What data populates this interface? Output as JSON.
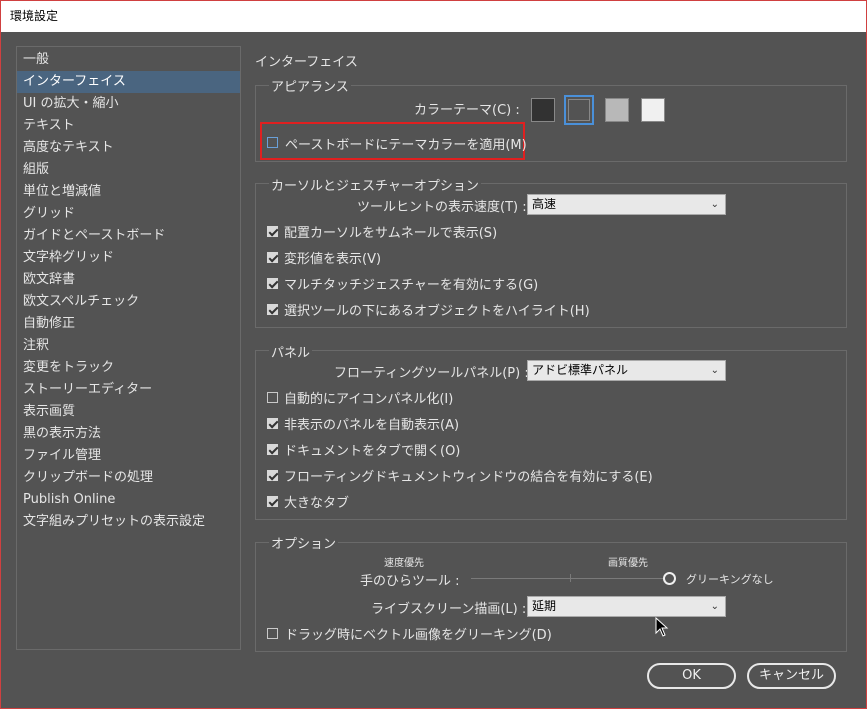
{
  "window": {
    "title": "環境設定"
  },
  "sidebar": {
    "items": [
      {
        "label": "一般"
      },
      {
        "label": "インターフェイス",
        "selected": true
      },
      {
        "label": "UI の拡大・縮小"
      },
      {
        "label": "テキスト"
      },
      {
        "label": "高度なテキスト"
      },
      {
        "label": "組版"
      },
      {
        "label": "単位と増減値"
      },
      {
        "label": "グリッド"
      },
      {
        "label": "ガイドとペーストボード"
      },
      {
        "label": "文字枠グリッド"
      },
      {
        "label": "欧文辞書"
      },
      {
        "label": "欧文スペルチェック"
      },
      {
        "label": "自動修正"
      },
      {
        "label": "注釈"
      },
      {
        "label": "変更をトラック"
      },
      {
        "label": "ストーリーエディター"
      },
      {
        "label": "表示画質"
      },
      {
        "label": "黒の表示方法"
      },
      {
        "label": "ファイル管理"
      },
      {
        "label": "クリップボードの処理"
      },
      {
        "label": "Publish Online"
      },
      {
        "label": "文字組みプリセットの表示設定"
      }
    ]
  },
  "main": {
    "title": "インターフェイス",
    "appearance": {
      "legend": "アピアランス",
      "color_theme_label": "カラーテーマ(C) :",
      "swatch_colors": [
        "#323232",
        "#535353",
        "#b8b8b8",
        "#f0f0f0"
      ],
      "selected_swatch": 1,
      "pasteboard_label": "ペーストボードにテーマカラーを適用(M)",
      "pasteboard_checked": false
    },
    "cursor_gesture": {
      "legend": "カーソルとジェスチャーオプション",
      "tooltip_label": "ツールヒントの表示速度(T) :",
      "tooltip_value": "高速",
      "checkboxes": [
        {
          "label": "配置カーソルをサムネールで表示(S)",
          "checked": true
        },
        {
          "label": "変形値を表示(V)",
          "checked": true
        },
        {
          "label": "マルチタッチジェスチャーを有効にする(G)",
          "checked": true
        },
        {
          "label": "選択ツールの下にあるオブジェクトをハイライト(H)",
          "checked": true
        }
      ]
    },
    "panels": {
      "legend": "パネル",
      "floating_label": "フローティングツールパネル(P) :",
      "floating_value": "アドビ標準パネル",
      "checkboxes": [
        {
          "label": "自動的にアイコンパネル化(I)",
          "checked": false
        },
        {
          "label": "非表示のパネルを自動表示(A)",
          "checked": true
        },
        {
          "label": "ドキュメントをタブで開く(O)",
          "checked": true
        },
        {
          "label": "フローティングドキュメントウィンドウの結合を有効にする(E)",
          "checked": true
        },
        {
          "label": "大きなタブ",
          "checked": true
        }
      ]
    },
    "options": {
      "legend": "オプション",
      "speed_label": "速度優先",
      "quality_label": "画質優先",
      "hand_tool_label": "手のひらツール :",
      "greeking_label": "グリーキングなし",
      "hand_tool_level": 1.0,
      "live_draw_label": "ライブスクリーン描画(L) :",
      "live_draw_value": "延期",
      "drag_label": "ドラッグ時にベクトル画像をグリーキング(D)",
      "drag_checked": false
    }
  },
  "buttons": {
    "ok": "OK",
    "cancel": "キャンセル"
  }
}
